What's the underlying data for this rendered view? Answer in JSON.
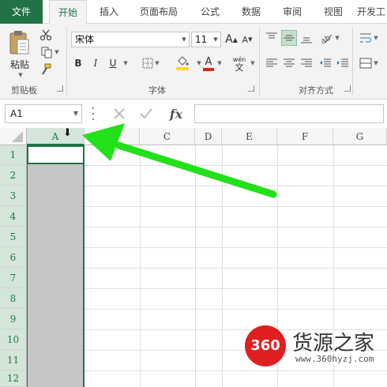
{
  "tabs": [
    {
      "label": "文件"
    },
    {
      "label": "开始"
    },
    {
      "label": "插入"
    },
    {
      "label": "页面布局"
    },
    {
      "label": "公式"
    },
    {
      "label": "数据"
    },
    {
      "label": "审阅"
    },
    {
      "label": "视图"
    },
    {
      "label": "开发工"
    }
  ],
  "active_tab": "开始",
  "clipboard": {
    "paste_label": "粘贴",
    "group_label": "剪贴板"
  },
  "font": {
    "name": "宋体",
    "size": "11",
    "grow": "A",
    "shrink": "A",
    "bold": "B",
    "italic": "I",
    "underline": "U",
    "font_color_letter": "A",
    "phonetic_top": "wén",
    "phonetic_bottom": "文",
    "group_label": "字体",
    "font_color": "#d9261c",
    "fill_color": "#ffdf00"
  },
  "alignment": {
    "group_label": "对齐方式"
  },
  "formula_bar": {
    "name_box": "A1",
    "fx_label": "fx",
    "formula": ""
  },
  "columns": [
    "A",
    "B",
    "C",
    "D",
    "E",
    "F",
    "G"
  ],
  "rows": [
    "1",
    "2",
    "3",
    "4",
    "5",
    "6",
    "7",
    "8",
    "9",
    "10",
    "11",
    "12"
  ],
  "selected_column": "A",
  "annotation": {
    "cursor_glyph": "⬇",
    "arrow_color": "#22e01a"
  },
  "watermark": {
    "logo": "360",
    "name": "货源之家",
    "url": "www.360hyzj.com"
  },
  "colors": {
    "accent": "#217346",
    "selection_fill": "#c6c6c6"
  }
}
